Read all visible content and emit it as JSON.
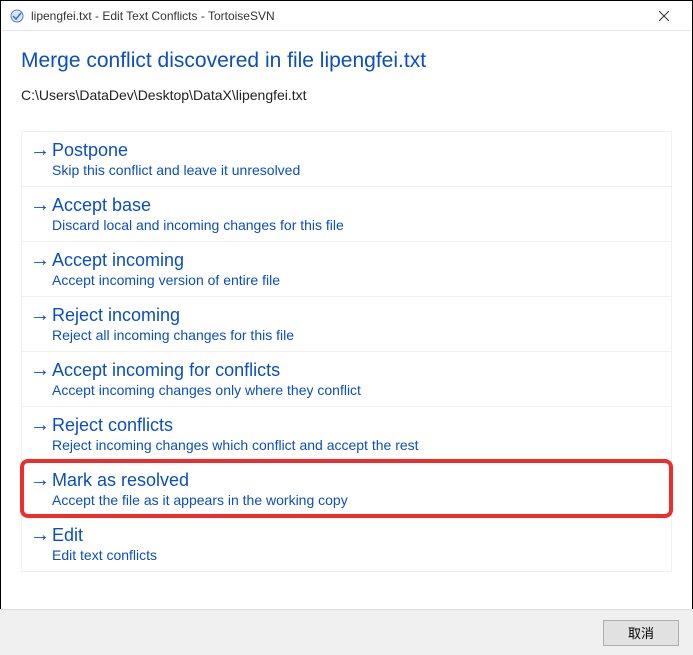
{
  "window": {
    "title": "lipengfei.txt - Edit Text Conflicts - TortoiseSVN"
  },
  "heading": "Merge conflict discovered in file lipengfei.txt",
  "filepath": "C:\\Users\\DataDev\\Desktop\\DataX\\lipengfei.txt",
  "options": [
    {
      "title": "Postpone",
      "desc": "Skip this conflict and leave it unresolved",
      "highlight": false
    },
    {
      "title": "Accept base",
      "desc": "Discard local and incoming changes for this file",
      "highlight": false
    },
    {
      "title": "Accept incoming",
      "desc": "Accept incoming version of entire file",
      "highlight": false
    },
    {
      "title": "Reject incoming",
      "desc": "Reject all incoming changes for this file",
      "highlight": false
    },
    {
      "title": "Accept incoming for conflicts",
      "desc": "Accept incoming changes only where they conflict",
      "highlight": false
    },
    {
      "title": "Reject conflicts",
      "desc": "Reject incoming changes which conflict and accept the rest",
      "highlight": false
    },
    {
      "title": "Mark as resolved",
      "desc": "Accept the file as it appears in the working copy",
      "highlight": true
    },
    {
      "title": "Edit",
      "desc": "Edit text conflicts",
      "highlight": false
    }
  ],
  "buttons": {
    "cancel": "取消"
  }
}
